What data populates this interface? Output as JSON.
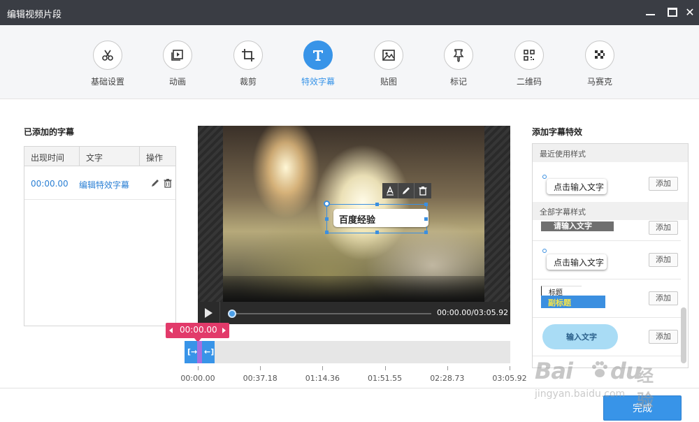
{
  "window": {
    "title": "编辑视频片段"
  },
  "toolbar": {
    "tools": [
      {
        "label": "基础设置",
        "icon": "scissors-icon"
      },
      {
        "label": "动画",
        "icon": "play-frame-icon"
      },
      {
        "label": "裁剪",
        "icon": "crop-icon"
      },
      {
        "label": "特效字幕",
        "icon": "text-t-icon",
        "active": true
      },
      {
        "label": "贴图",
        "icon": "image-icon"
      },
      {
        "label": "标记",
        "icon": "pin-icon"
      },
      {
        "label": "二维码",
        "icon": "qrcode-icon"
      },
      {
        "label": "马赛克",
        "icon": "mosaic-icon"
      }
    ],
    "accent_color": "#3894e8"
  },
  "subtitles": {
    "title": "已添加的字幕",
    "columns": [
      "出现时间",
      "文字",
      "操作"
    ],
    "rows": [
      {
        "time": "00:00.00",
        "text": "编辑特效字幕"
      }
    ]
  },
  "preview": {
    "caption": "百度经验",
    "caption_tools": [
      "text-style-icon",
      "edit-icon",
      "delete-icon"
    ],
    "time": "00:00.00/03:05.92",
    "progress": 0
  },
  "timeline": {
    "current": "00:00.00",
    "markers": [
      "[→",
      "←]"
    ],
    "ticks": [
      "00:00.00",
      "00:37.18",
      "01:14.36",
      "01:51.55",
      "02:28.73",
      "03:05.92"
    ]
  },
  "effects": {
    "title": "添加字幕特效",
    "recent_label": "最近使用样式",
    "all_label": "全部字幕样式",
    "add_label": "添加",
    "recent_sample": "点击输入文字",
    "samples": {
      "dark": "请输入文字",
      "bubble": "点击输入文字",
      "title_top": "标题",
      "title_bottom": "副标题",
      "cloud": "输入文字"
    }
  },
  "footer": {
    "done_label": "完成"
  },
  "watermark": {
    "brand": "Bai",
    "brand_end": "du",
    "cn": "经验",
    "url": "jingyan.baidu.com"
  }
}
